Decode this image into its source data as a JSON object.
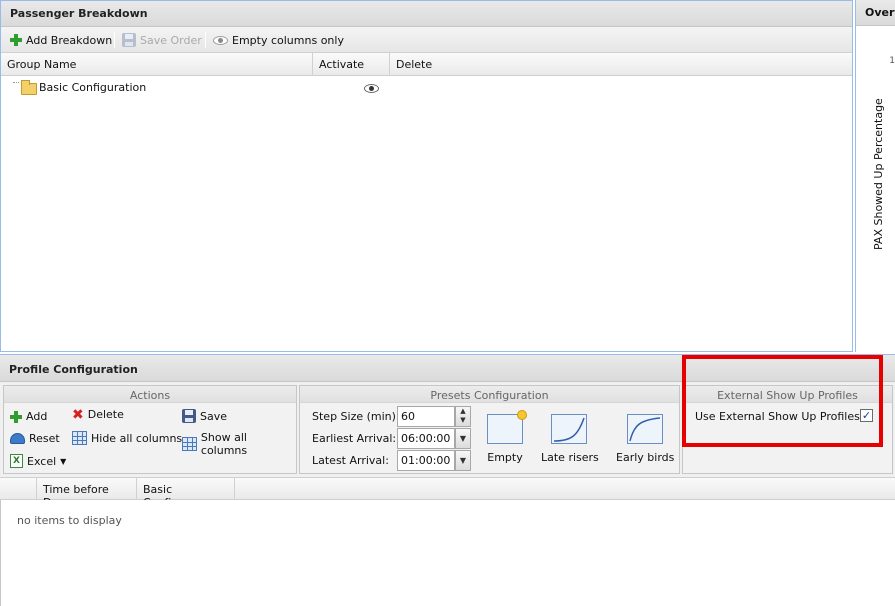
{
  "passenger_breakdown": {
    "title": "Passenger Breakdown",
    "toolbar": {
      "add_label": "Add Breakdown",
      "save_label": "Save Order",
      "empty_columns_label": "Empty columns only"
    },
    "columns": [
      "Group Name",
      "Activate",
      "Delete"
    ],
    "rows": [
      {
        "name": "Basic Configuration",
        "activate_icon": "eye-icon"
      }
    ]
  },
  "overview": {
    "title": "Overv",
    "y_axis_label": "PAX Showed Up Percentage",
    "tick": "1"
  },
  "profile_configuration": {
    "title": "Profile Configuration",
    "actions": {
      "title": "Actions",
      "add": "Add",
      "delete": "Delete",
      "save": "Save",
      "reset": "Reset",
      "hide_all": "Hide all columns",
      "show_all": "Show all columns",
      "excel": "Excel"
    },
    "presets": {
      "title": "Presets Configuration",
      "step_size_label": "Step Size (min):",
      "step_size_value": "60",
      "earliest_label": "Earliest Arrival:",
      "earliest_value": "06:00:00",
      "latest_label": "Latest Arrival:",
      "latest_value": "01:00:00",
      "items": [
        "Empty",
        "Late risers",
        "Early birds"
      ]
    },
    "external": {
      "title": "External Show Up Profiles",
      "use_label": "Use External Show Up Profiles:",
      "checked": true,
      "check_glyph": "✓"
    },
    "grid": {
      "columns": [
        "",
        "Time before De...",
        "Basic Configura..."
      ],
      "empty_text": "no items to display"
    }
  },
  "colors": {
    "highlight": "#e60000",
    "panel_border": "#99bbe8"
  }
}
